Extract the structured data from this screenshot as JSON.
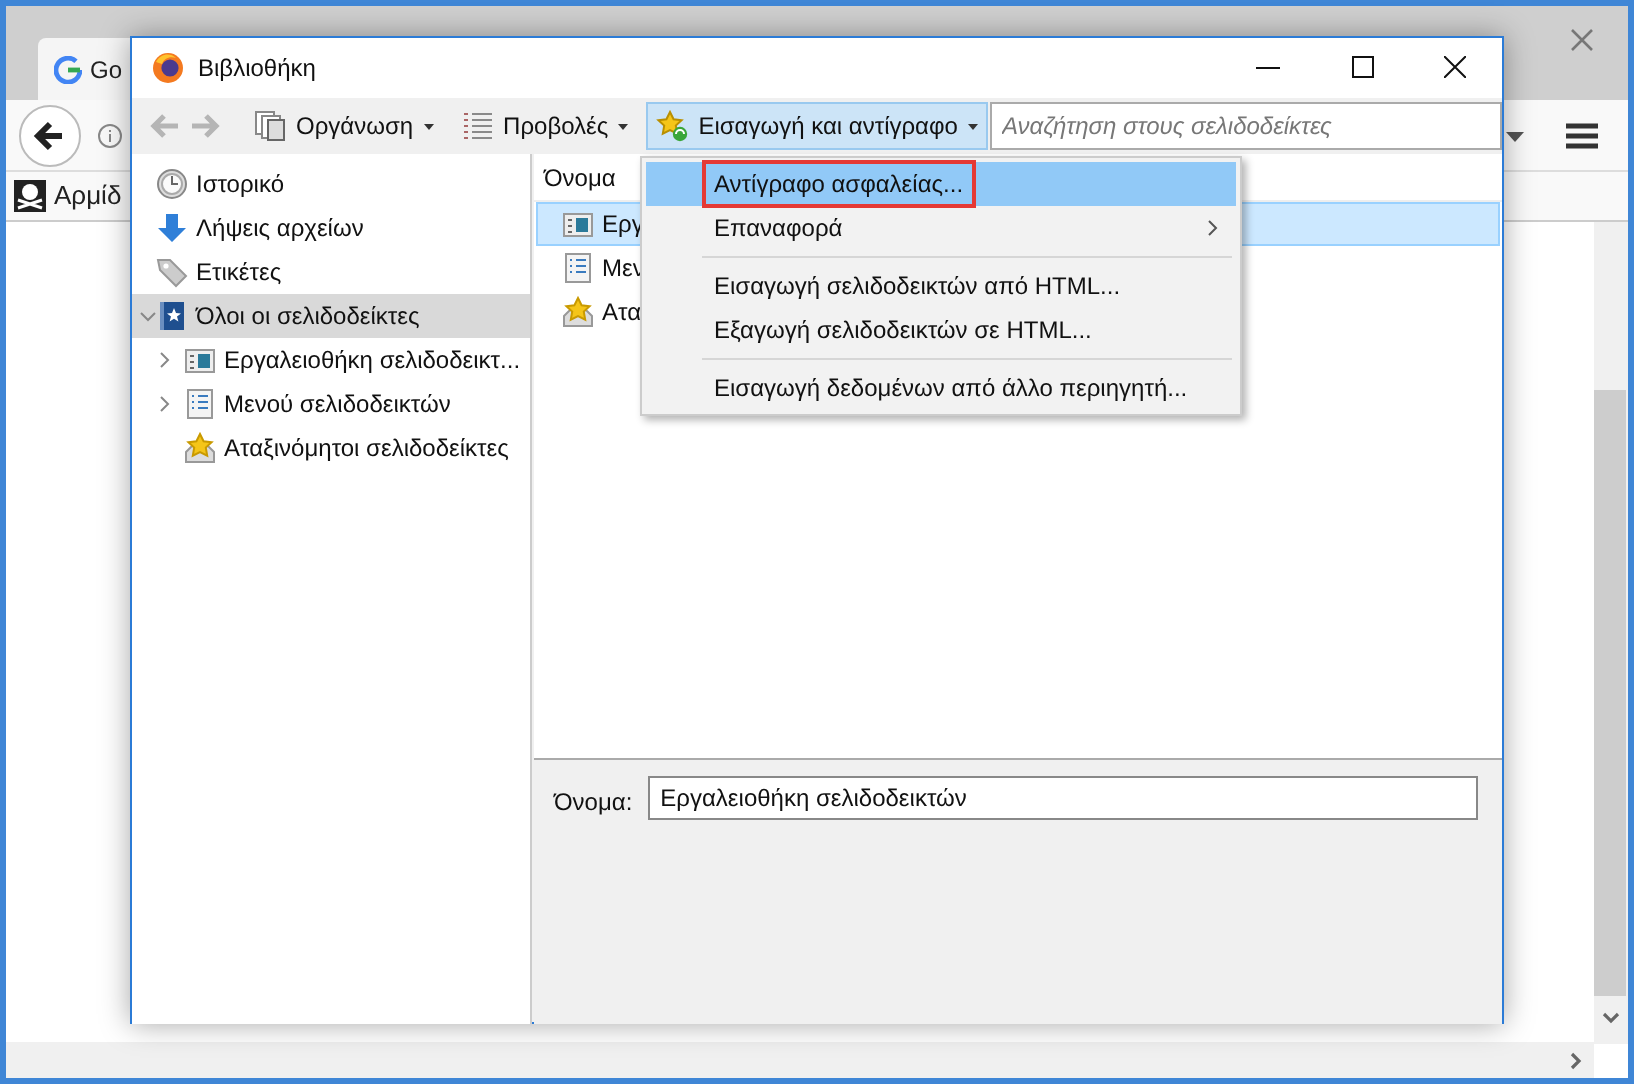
{
  "browser": {
    "tab": {
      "title": "Go"
    },
    "bookmark": {
      "label": "Αρμίδ"
    }
  },
  "library": {
    "title": "Βιβλιοθήκη",
    "toolbar": {
      "buttons": [
        {
          "kind": "organize",
          "label": "Οργάνωση",
          "active": false
        },
        {
          "kind": "views",
          "label": "Προβολές",
          "active": false
        },
        {
          "kind": "import",
          "label": "Εισαγωγή και αντίγραφο",
          "active": true
        }
      ],
      "search": {
        "placeholder": "Αναζήτηση στους σελιδοδείκτες"
      }
    },
    "sidebar": {
      "items": [
        {
          "kind": "history",
          "label": "Ιστορικό",
          "selected": false
        },
        {
          "kind": "downloads",
          "label": "Λήψεις αρχείων",
          "selected": false
        },
        {
          "kind": "tags",
          "label": "Ετικέτες",
          "selected": false
        },
        {
          "kind": "all",
          "label": "Όλοι οι σελιδοδείκτες",
          "selected": true,
          "expanded": true,
          "children": [
            {
              "kind": "toolbar",
              "label": "Εργαλειοθήκη σελιδοδεικτ...",
              "selected": false,
              "expanded": false
            },
            {
              "kind": "menu",
              "label": "Μενού σελιδοδεικτών",
              "selected": false,
              "expanded": false
            },
            {
              "kind": "unsorted",
              "label": "Αταξινόμητοι σελιδοδείκτες",
              "selected": false
            }
          ]
        }
      ]
    },
    "list": {
      "columns": [
        "Όνομα"
      ],
      "rows": [
        {
          "kind": "toolbar",
          "name": "Εργ",
          "selected": true
        },
        {
          "kind": "menu",
          "name": "Μεν",
          "selected": false
        },
        {
          "kind": "unsorted",
          "name": "Ατα",
          "selected": false
        }
      ]
    },
    "details": {
      "label": "Όνομα:",
      "value": "Εργαλειοθήκη σελιδοδεικτών"
    },
    "menu": {
      "items": [
        {
          "kind": "item",
          "label": "Αντίγραφο ασφαλείας...",
          "selected": true,
          "outlined": true
        },
        {
          "kind": "submenu",
          "label": "Επαναφορά",
          "selected": false
        },
        {
          "kind": "separator"
        },
        {
          "kind": "item",
          "label": "Εισαγωγή σελιδοδεικτών από HTML...",
          "selected": false
        },
        {
          "kind": "item",
          "label": "Εξαγωγή σελιδοδεικτών σε HTML...",
          "selected": false
        },
        {
          "kind": "separator"
        },
        {
          "kind": "item",
          "label": "Εισαγωγή δεδομένων από άλλο περιηγητή...",
          "selected": false
        }
      ]
    }
  }
}
